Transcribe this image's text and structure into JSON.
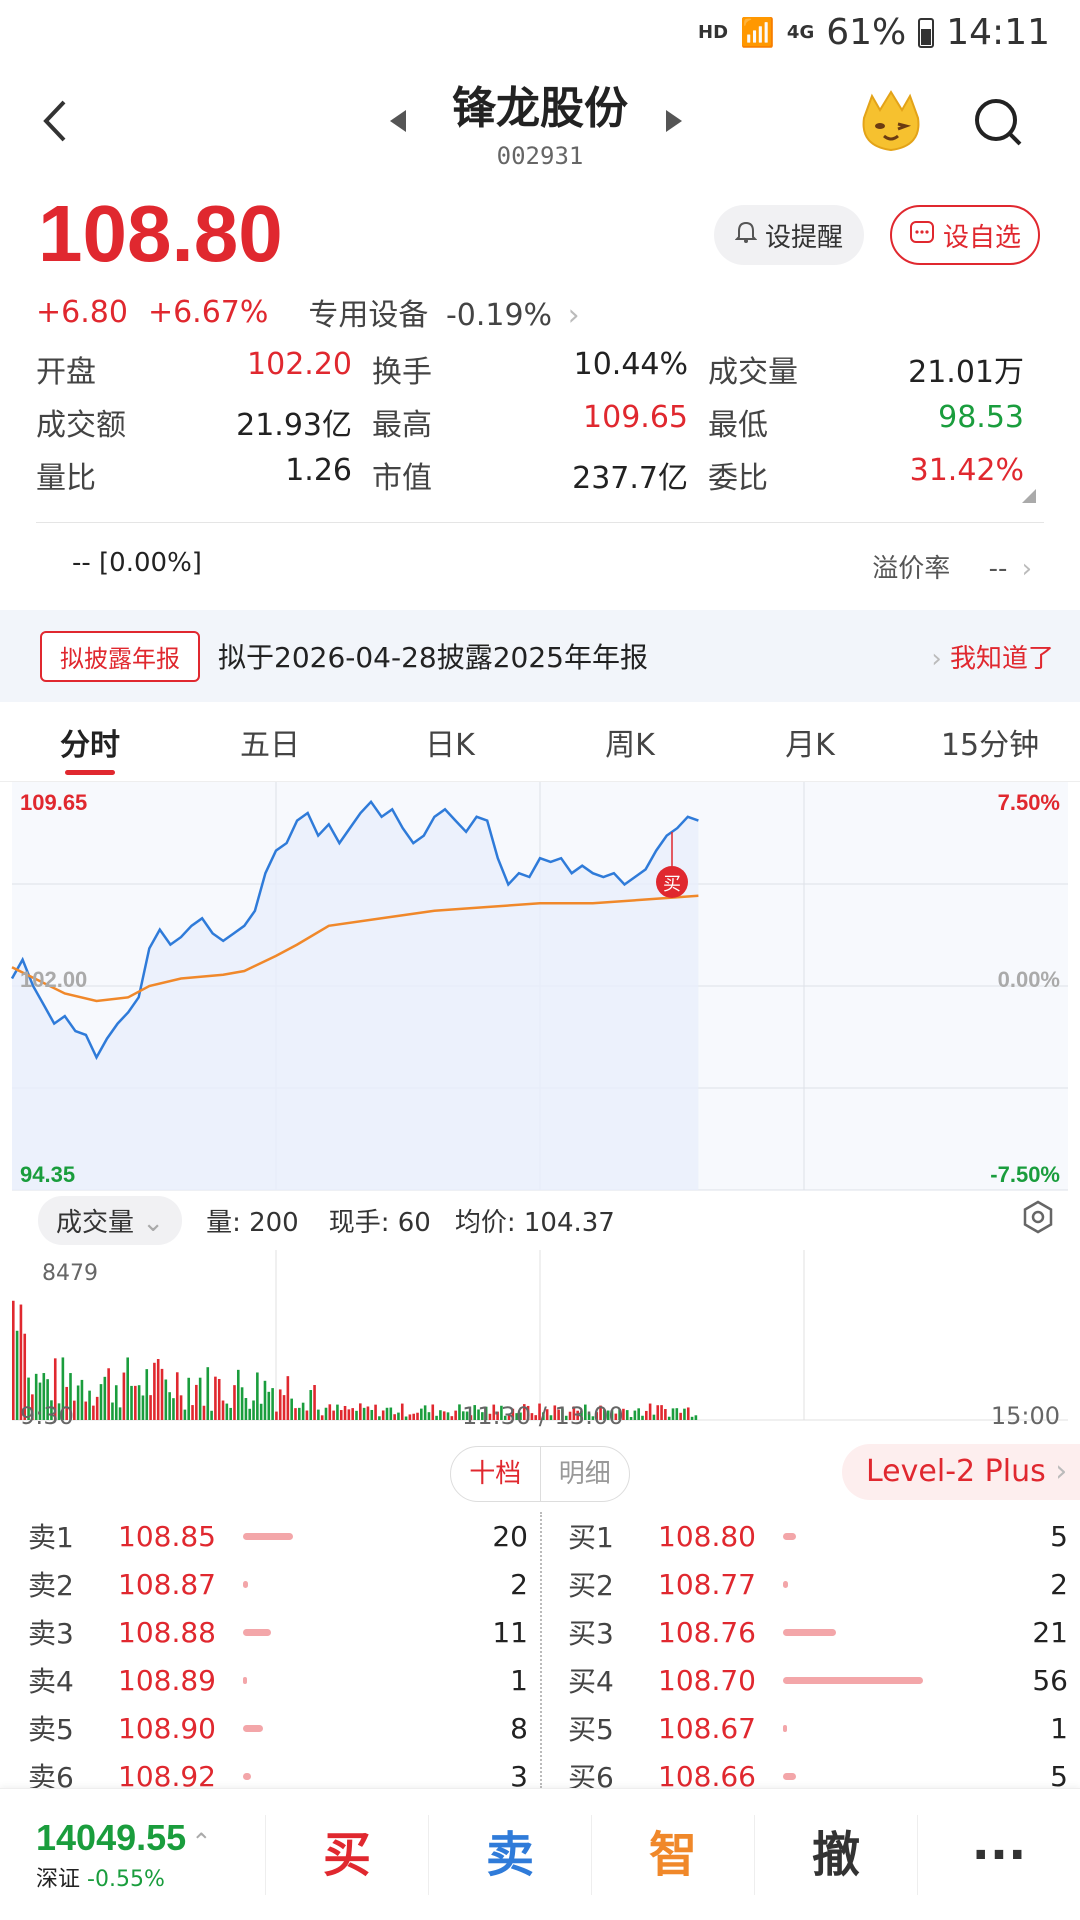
{
  "status": {
    "hd": "HD",
    "network": "4G",
    "battery": "61%",
    "time": "14:11"
  },
  "header": {
    "name": "锋龙股份",
    "code": "002931"
  },
  "quote": {
    "price": "108.80",
    "change": "+6.80",
    "change_pct": "+6.67%",
    "sector": "专用设备",
    "sector_pct": "-0.19%",
    "remind_label": "设提醒",
    "fav_label": "设自选"
  },
  "stats": [
    [
      {
        "label": "开盘",
        "value": "102.20",
        "color": "red"
      },
      {
        "label": "换手",
        "value": "10.44%",
        "color": "plain"
      },
      {
        "label": "成交量",
        "value": "21.01万",
        "color": "plain"
      }
    ],
    [
      {
        "label": "成交额",
        "value": "21.93亿",
        "color": "plain"
      },
      {
        "label": "最高",
        "value": "109.65",
        "color": "red"
      },
      {
        "label": "最低",
        "value": "98.53",
        "color": "green"
      }
    ],
    [
      {
        "label": "量比",
        "value": "1.26",
        "color": "plain"
      },
      {
        "label": "市值",
        "value": "237.7亿",
        "color": "plain"
      },
      {
        "label": "委比",
        "value": "31.42%",
        "color": "red"
      }
    ]
  ],
  "premium": {
    "left": "-- [0.00%]",
    "label": "溢价率",
    "value": "--"
  },
  "banner": {
    "badge": "拟披露年报",
    "text": "拟于2026-04-28披露2025年年报",
    "link": "我知道了"
  },
  "tabs": [
    "分时",
    "五日",
    "日K",
    "周K",
    "月K",
    "15分钟"
  ],
  "chart_labels": {
    "high": "109.65",
    "low": "94.35",
    "mid": "102.00",
    "pct_high": "7.50%",
    "pct_mid": "0.00%",
    "pct_low": "-7.50%",
    "buy_marker": "买"
  },
  "volume_bar": {
    "selector": "成交量",
    "vol": "量: 200",
    "now": "现手: 60",
    "avg": "均价: 104.37",
    "max": "8479"
  },
  "times": {
    "start": "9:30",
    "mid": "11:30 / 13:00",
    "end": "15:00"
  },
  "orderbook_tabs": {
    "active": "十档",
    "other": "明细",
    "level2": "Level-2 Plus"
  },
  "sells": [
    {
      "label": "卖1",
      "price": "108.85",
      "qty": "20"
    },
    {
      "label": "卖2",
      "price": "108.87",
      "qty": "2"
    },
    {
      "label": "卖3",
      "price": "108.88",
      "qty": "11"
    },
    {
      "label": "卖4",
      "price": "108.89",
      "qty": "1"
    },
    {
      "label": "卖5",
      "price": "108.90",
      "qty": "8"
    },
    {
      "label": "卖6",
      "price": "108.92",
      "qty": "3"
    }
  ],
  "buys": [
    {
      "label": "买1",
      "price": "108.80",
      "qty": "5"
    },
    {
      "label": "买2",
      "price": "108.77",
      "qty": "2"
    },
    {
      "label": "买3",
      "price": "108.76",
      "qty": "21"
    },
    {
      "label": "买4",
      "price": "108.70",
      "qty": "56"
    },
    {
      "label": "买5",
      "price": "108.67",
      "qty": "1"
    },
    {
      "label": "买6",
      "price": "108.66",
      "qty": "5"
    }
  ],
  "bottom": {
    "index_value": "14049.55",
    "index_name": "深证",
    "index_pct": "-0.55%",
    "actions": [
      "买",
      "卖",
      "智",
      "撤",
      "···"
    ]
  },
  "colors": {
    "red": "#e0282f",
    "green": "#1a9d3d",
    "price_line": "#2f7bd9",
    "avg_line": "#f0882a"
  }
}
